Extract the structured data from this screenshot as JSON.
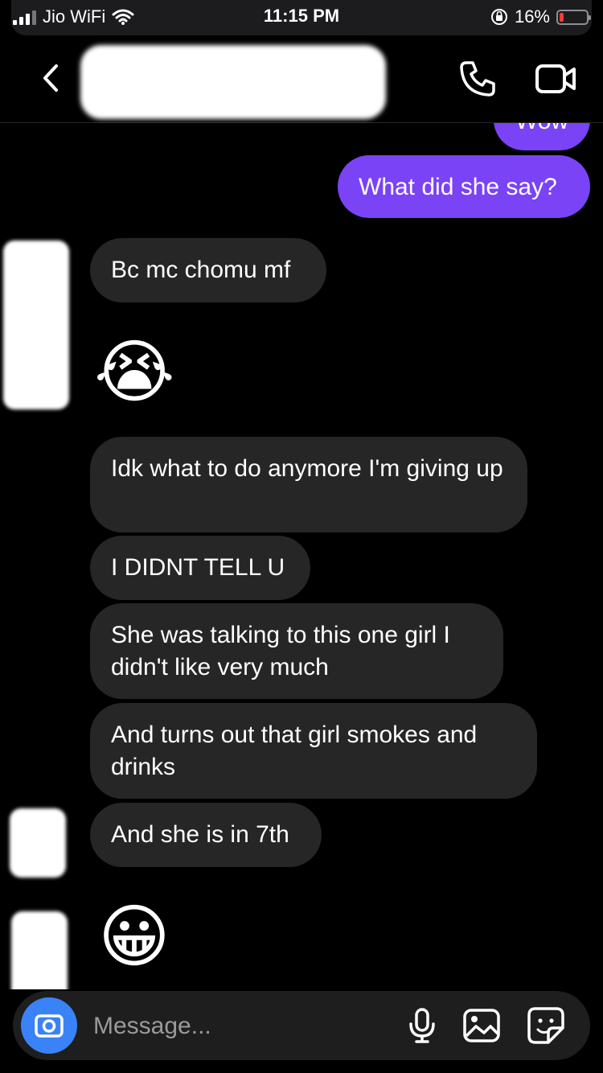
{
  "status_bar": {
    "carrier": "Jio WiFi",
    "time": "11:15 PM",
    "battery_percent": "16%",
    "battery_level": 0.16,
    "icons": [
      "signal-icon",
      "wifi-icon",
      "orientation-lock-icon",
      "battery-icon"
    ]
  },
  "header": {
    "contact_name": "",
    "icons": [
      "back-icon",
      "phone-icon",
      "video-camera-icon"
    ]
  },
  "messages": {
    "m0": "Wow",
    "m1": "What did she say?",
    "m2": "Bc mc chomu mf",
    "m3": "😭",
    "m4": "Idk what to do anymore I'm giving up",
    "m5": "I DIDNT TELL U",
    "m6": "She was talking to this one girl I didn't like very much",
    "m7": "And turns out that girl smokes and drinks",
    "m8": "And she is in 7th",
    "m9": "😀"
  },
  "composer": {
    "placeholder": "Message...",
    "icons": [
      "camera-icon",
      "microphone-icon",
      "gallery-icon",
      "sticker-icon"
    ]
  },
  "colors": {
    "outgoing_bubble": "#7a43f5",
    "incoming_bubble": "#262626",
    "camera_button": "#3a82f7",
    "background": "#000000"
  }
}
